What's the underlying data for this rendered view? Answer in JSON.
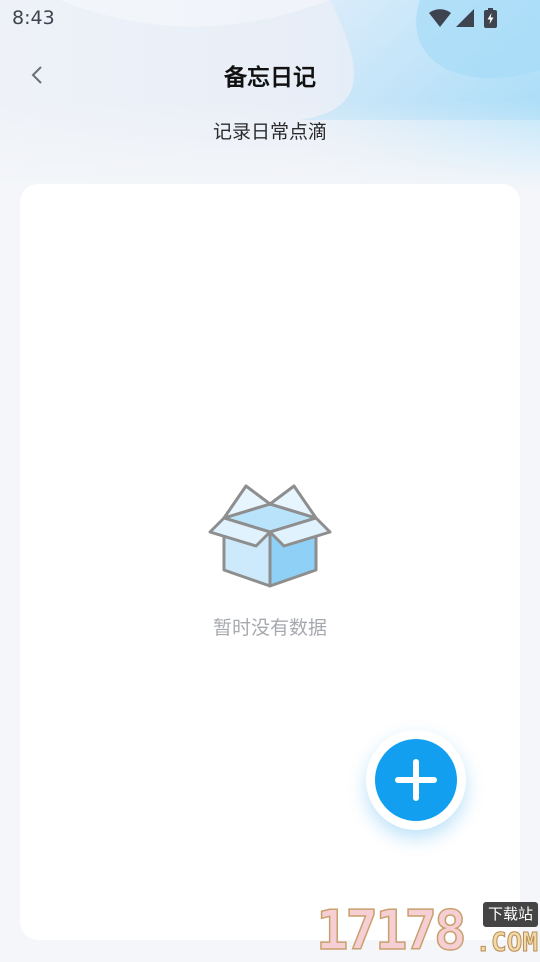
{
  "status_bar": {
    "time": "8:43",
    "icons": [
      "wifi-icon",
      "signal-icon",
      "battery-charging-icon"
    ]
  },
  "header": {
    "back_icon": "chevron-left-icon",
    "title": "备忘日记"
  },
  "subtitle": "记录日常点滴",
  "empty_state": {
    "icon": "open-box-icon",
    "text": "暂时没有数据"
  },
  "fab": {
    "icon": "plus-icon",
    "color": "#129ff0"
  },
  "watermark": {
    "number": "17178",
    "badge": "下载站",
    "domain": ".COM"
  },
  "colors": {
    "page_background": "#f4f6f9",
    "card_background": "#ffffff",
    "accent": "#129ff0"
  }
}
